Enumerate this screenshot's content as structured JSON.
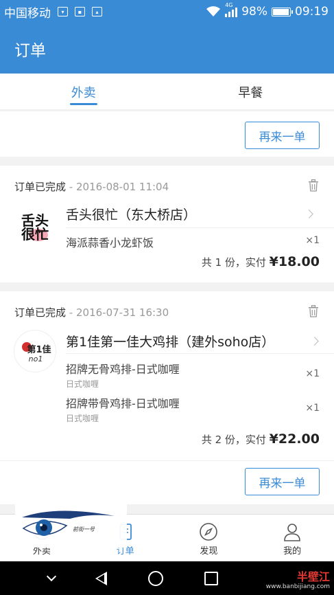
{
  "status_bar": {
    "carrier": "中国移动",
    "network": "4G",
    "battery": "98%",
    "time": "09:19"
  },
  "app_bar": {
    "title": "订单"
  },
  "tabs": [
    {
      "label": "外卖",
      "active": true
    },
    {
      "label": "早餐",
      "active": false
    }
  ],
  "orders": [
    {
      "partial": true,
      "reorder_label": "再来一单"
    },
    {
      "status": "订单已完成",
      "timestamp": "- 2016-08-01 11:04",
      "shop_name": "舌头很忙（东大桥店）",
      "logo_text": "舌头很忙",
      "items": [
        {
          "name": "海派蒜香小龙虾饭",
          "sub": "",
          "qty": "×1"
        }
      ],
      "summary_prefix": "共 1 份，实付 ",
      "summary_amount": "¥18.00"
    },
    {
      "status": "订单已完成",
      "timestamp": "- 2016-07-31 16:30",
      "shop_name": "第1佳第一佳大鸡排（建外soho店）",
      "logo_text": "第1佳",
      "items": [
        {
          "name": "招牌无骨鸡排-日式咖喱",
          "sub": "日式咖喱",
          "qty": "×1"
        },
        {
          "name": "招牌带骨鸡排-日式咖喱",
          "sub": "日式咖喱",
          "qty": "×1"
        }
      ],
      "summary_prefix": "共 2 份，实付 ",
      "summary_amount": "¥22.00",
      "reorder_label": "再来一单"
    }
  ],
  "bottom_nav": [
    {
      "label": "外卖",
      "icon": "takeout-icon",
      "active": false
    },
    {
      "label": "订单",
      "icon": "order-icon",
      "active": true
    },
    {
      "label": "发现",
      "icon": "compass-icon",
      "active": false
    },
    {
      "label": "我的",
      "icon": "user-icon",
      "active": false
    }
  ],
  "watermark": {
    "text": "前街一号"
  },
  "brand": {
    "name": "半壁江",
    "url": "www.banbijiang.com"
  },
  "colors": {
    "accent": "#3a8bd6"
  }
}
